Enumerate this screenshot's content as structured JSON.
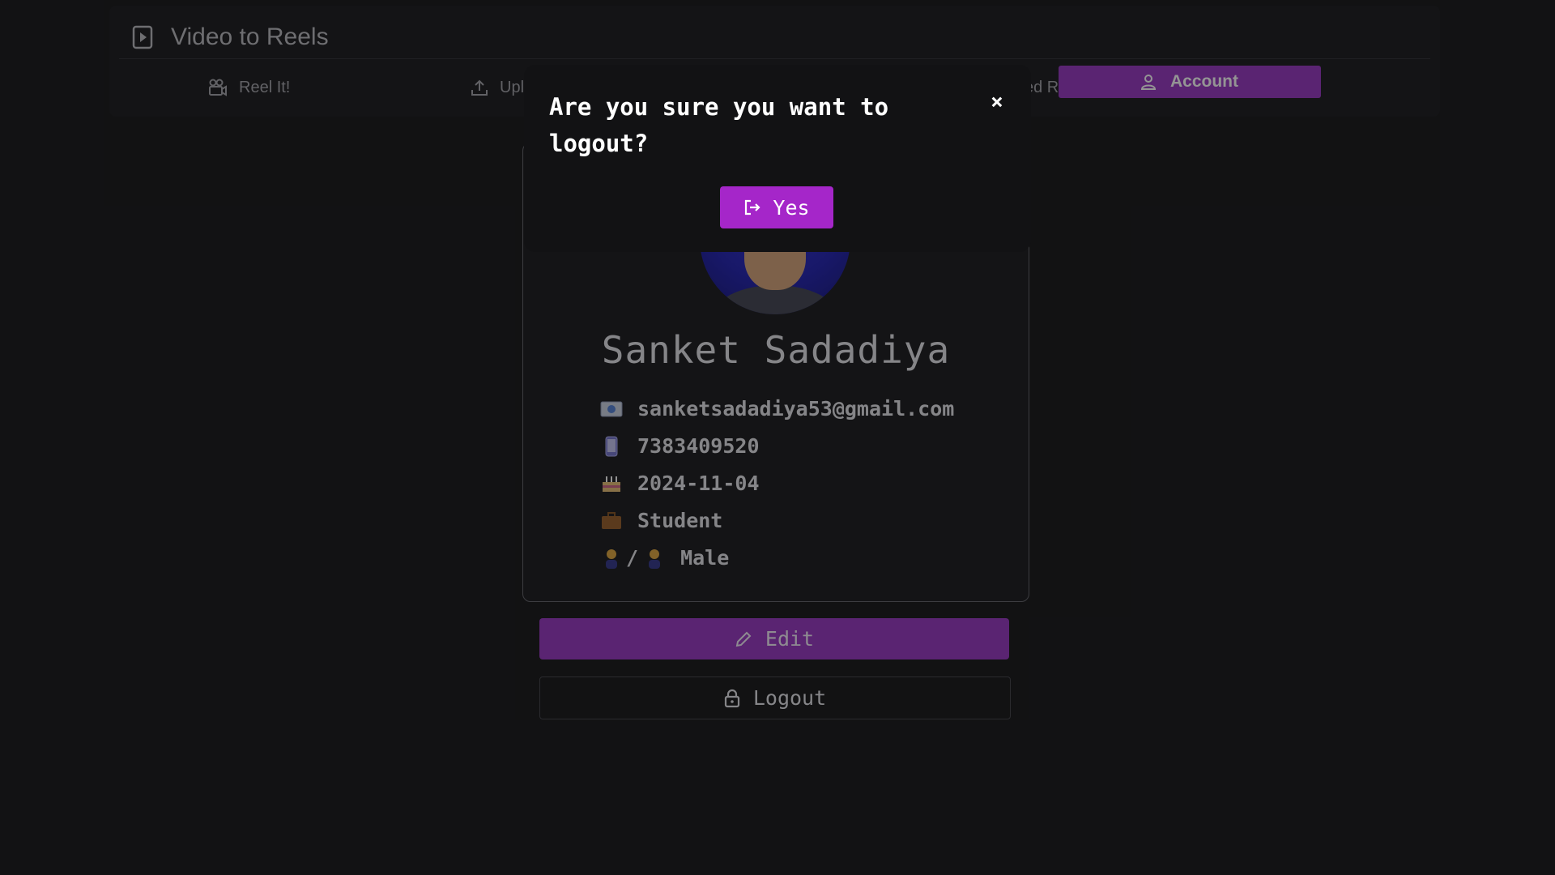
{
  "app": {
    "title": "Video to Reels"
  },
  "nav": {
    "items": [
      {
        "label": "Reel It!",
        "icon": "reel-icon"
      },
      {
        "label": "Upl",
        "icon": "upload-icon"
      },
      {
        "label": "ved Reels",
        "icon": ""
      }
    ],
    "active": {
      "label": "Account",
      "icon": "user-icon"
    }
  },
  "profile": {
    "name": "Sanket Sadadiya",
    "email": "sanketsadadiya53@gmail.com",
    "phone": "7383409520",
    "birthdate": "2024-11-04",
    "occupation": "Student",
    "gender_icons": "/",
    "gender": "Male"
  },
  "actions": {
    "edit_label": "Edit",
    "logout_label": "Logout"
  },
  "modal": {
    "title": "Are you sure you want to logout?",
    "close_symbol": "×",
    "confirm_label": "Yes"
  },
  "colors": {
    "accent": "#9b3fc4",
    "modal_button": "#a526c9",
    "background": "#1f1f22",
    "modal_bg": "#121214"
  }
}
